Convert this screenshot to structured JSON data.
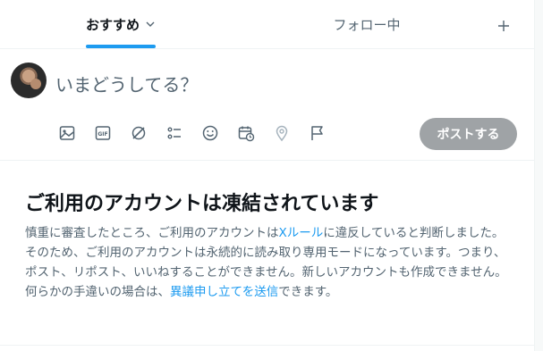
{
  "tabs": {
    "for_you": "おすすめ",
    "following": "フォロー中",
    "add": "+"
  },
  "composer": {
    "placeholder": "いまどうしてる？",
    "post_label": "ポストする",
    "tools": [
      "media-icon",
      "gif-icon",
      "grok-icon",
      "poll-icon",
      "emoji-icon",
      "schedule-icon",
      "location-icon",
      "flag-icon"
    ]
  },
  "notice": {
    "title": "ご利用のアカウントは凍結されています",
    "body_part1": "慎重に審査したところ、ご利用のアカウントは",
    "rules_link": "Xルール",
    "body_part2": "に違反していると判断しました。そのため、ご利用のアカウントは永続的に読み取り専用モードになっています。つまり、ポスト、リポスト、いいねすることができません。新しいアカウントも作成できません。何らかの手違いの場合は、",
    "appeal_link": "異議申し立てを送信",
    "body_part3": "できます。"
  },
  "colors": {
    "accent": "#1d9bf0",
    "text_primary": "#0f1419",
    "text_secondary": "#536471",
    "disabled_button": "#9fa3a6"
  }
}
